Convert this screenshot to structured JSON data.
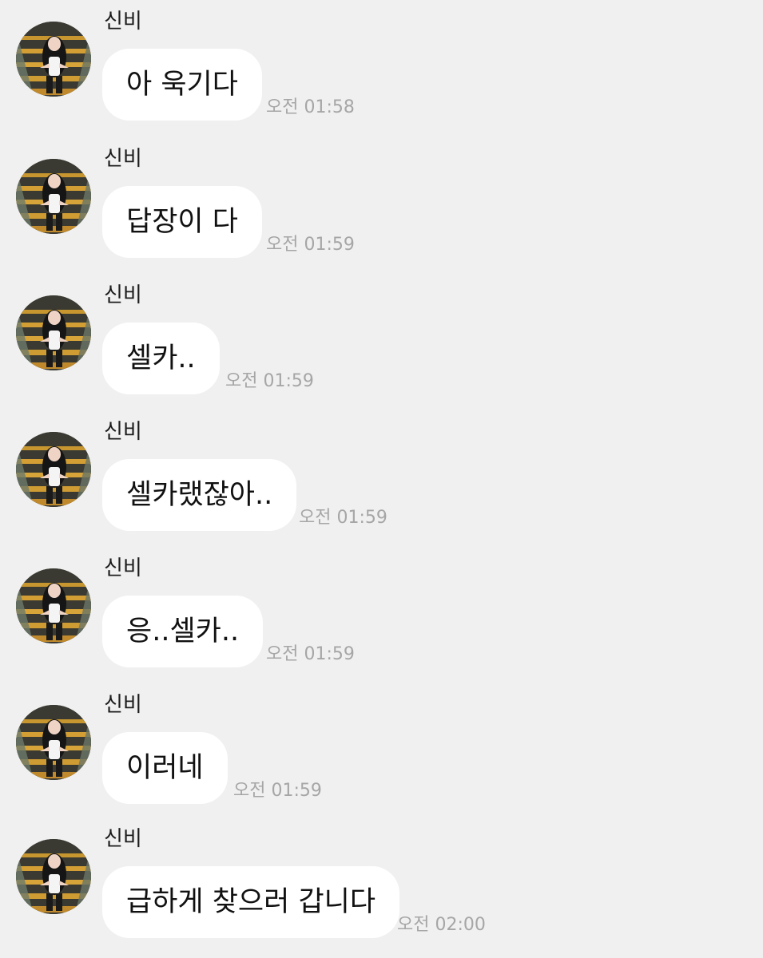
{
  "chat": {
    "messages": [
      {
        "sender": "신비",
        "text": "아 욱기다",
        "time": "오전 01:58"
      },
      {
        "sender": "신비",
        "text": "답장이 다",
        "time": "오전 01:59"
      },
      {
        "sender": "신비",
        "text": "셀카..",
        "time": "오전 01:59"
      },
      {
        "sender": "신비",
        "text": "셀카랬잖아..",
        "time": "오전 01:59"
      },
      {
        "sender": "신비",
        "text": "응..셀카..",
        "time": "오전 01:59"
      },
      {
        "sender": "신비",
        "text": "이러네",
        "time": "오전 01:59"
      },
      {
        "sender": "신비",
        "text": "급하게 찾으러 갑니다",
        "time": "오전 02:00"
      }
    ]
  },
  "colors": {
    "background": "#f0f0f0",
    "bubble": "#ffffff",
    "time_text": "#a6a6a6",
    "message_text": "#111111"
  },
  "icons": {
    "avatar": "profile-photo-avatar"
  }
}
